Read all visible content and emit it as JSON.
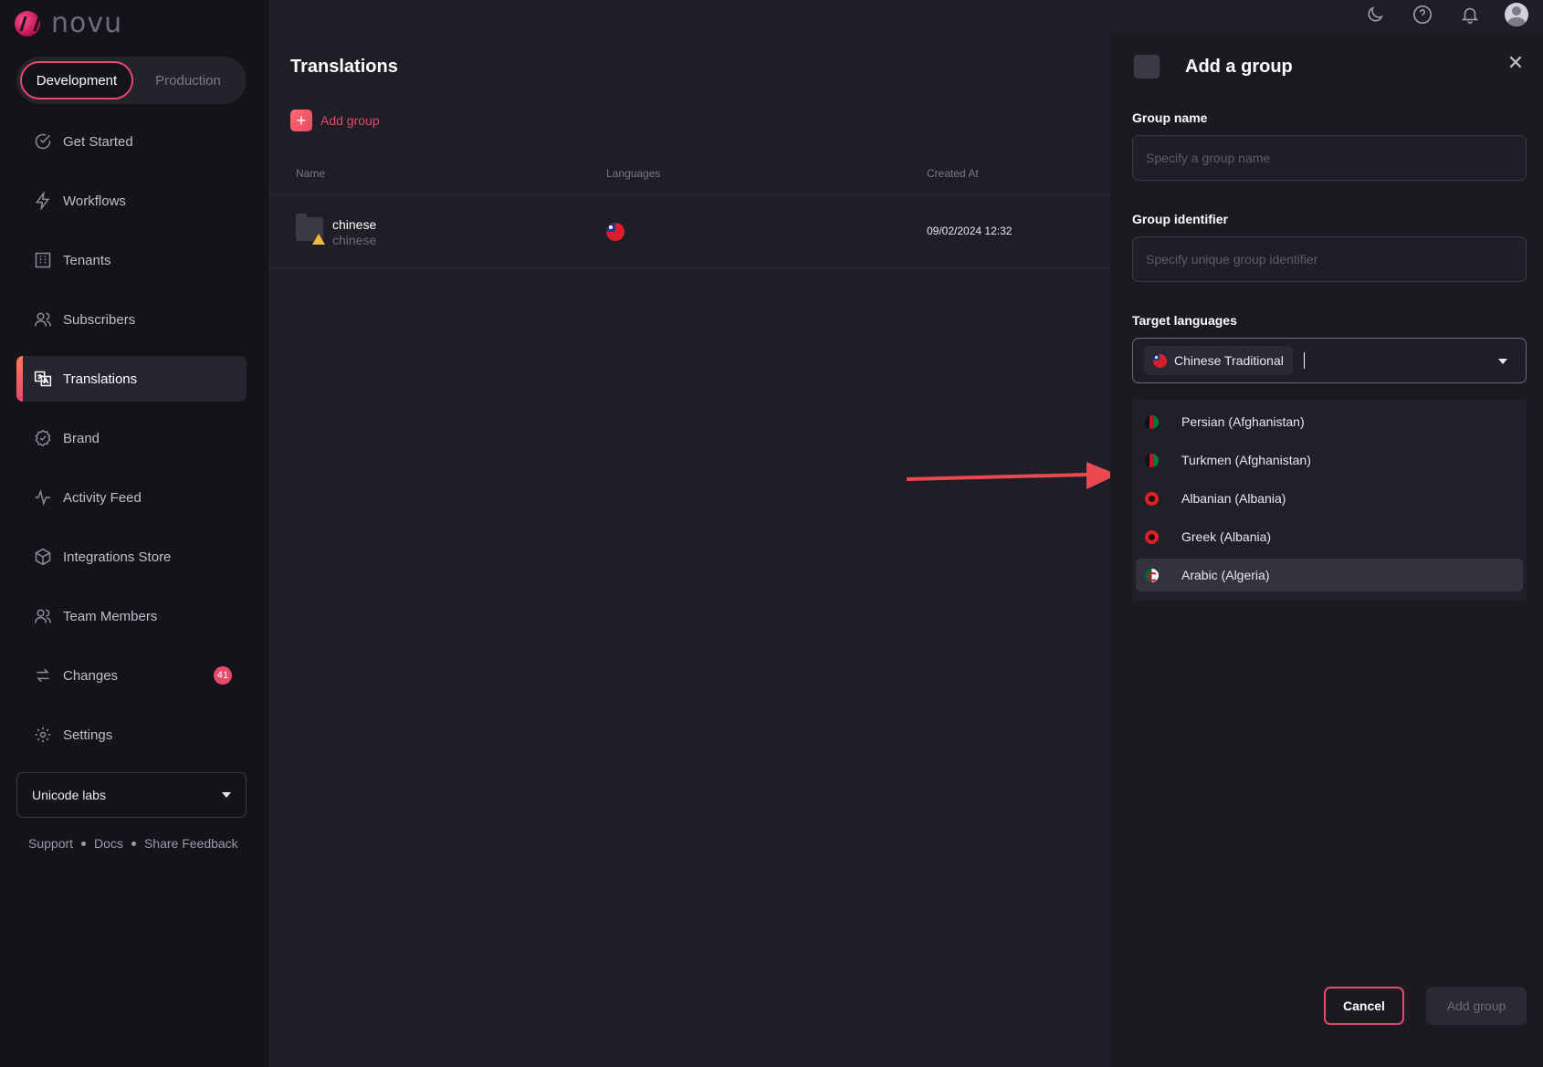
{
  "brand": {
    "name": "novu"
  },
  "environments": {
    "development": "Development",
    "production": "Production",
    "active": "Development"
  },
  "sidebar": {
    "items": [
      {
        "label": "Get Started",
        "icon": "check-circle-icon"
      },
      {
        "label": "Workflows",
        "icon": "bolt-icon"
      },
      {
        "label": "Tenants",
        "icon": "building-icon"
      },
      {
        "label": "Subscribers",
        "icon": "users-icon"
      },
      {
        "label": "Translations",
        "icon": "translate-icon",
        "active": true
      },
      {
        "label": "Brand",
        "icon": "brand-badge-icon"
      },
      {
        "label": "Activity Feed",
        "icon": "activity-icon"
      },
      {
        "label": "Integrations Store",
        "icon": "box-icon"
      },
      {
        "label": "Team Members",
        "icon": "team-icon"
      },
      {
        "label": "Changes",
        "icon": "sync-icon",
        "badge": "41"
      },
      {
        "label": "Settings",
        "icon": "gear-icon"
      }
    ],
    "organization": "Unicode labs",
    "footer": {
      "support": "Support",
      "docs": "Docs",
      "feedback": "Share Feedback"
    }
  },
  "main": {
    "title": "Translations",
    "add_group": "Add group",
    "table": {
      "columns": {
        "name": "Name",
        "languages": "Languages",
        "created_at": "Created At"
      },
      "rows": [
        {
          "name": "chinese",
          "identifier": "chinese",
          "created_at": "09/02/2024 12:32"
        }
      ]
    }
  },
  "drawer": {
    "title": "Add a group",
    "group_name": {
      "label": "Group name",
      "placeholder": "Specify a group name"
    },
    "group_identifier": {
      "label": "Group identifier",
      "placeholder": "Specify unique group identifier"
    },
    "target_languages": {
      "label": "Target languages",
      "selected": "Chinese Traditional",
      "options": [
        "Persian (Afghanistan)",
        "Turkmen (Afghanistan)",
        "Albanian (Albania)",
        "Greek (Albania)",
        "Arabic (Algeria)"
      ]
    },
    "cancel": "Cancel",
    "submit": "Add group"
  },
  "colors": {
    "accent": "#e8486a",
    "annotation_arrow": "#e84a4f"
  }
}
